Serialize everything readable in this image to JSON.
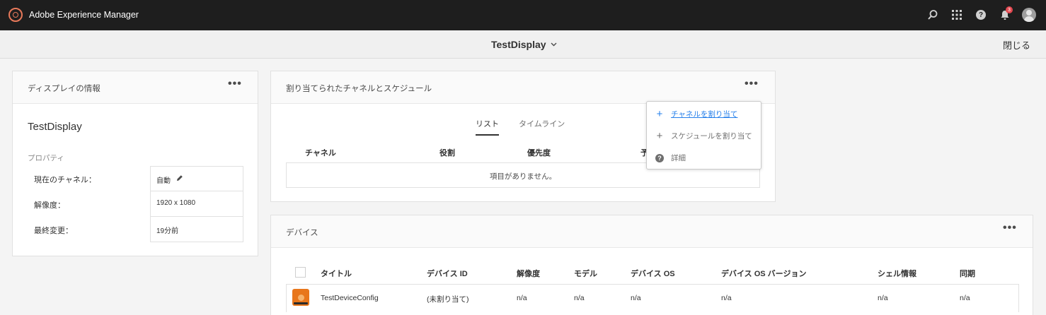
{
  "app": {
    "title": "Adobe Experience Manager",
    "notification_count": "3"
  },
  "header": {
    "page_title": "TestDisplay",
    "close_label": "閉じる"
  },
  "display_info": {
    "card_title": "ディスプレイの情報",
    "name": "TestDisplay",
    "properties_label": "プロパティ",
    "rows": [
      {
        "label": "現在のチャネル：",
        "value": "自動"
      },
      {
        "label": "解像度：",
        "value": "1920 x 1080"
      },
      {
        "label": "最終変更：",
        "value": "19分前"
      }
    ]
  },
  "channels": {
    "card_title": "割り当てられたチャネルとスケジュール",
    "tabs": [
      "リスト",
      "タイムライン"
    ],
    "columns": [
      "チャネル",
      "役割",
      "優先度",
      "予"
    ],
    "empty_text": "項目がありません。",
    "menu": {
      "assign_channel": "チャネルを割り当て",
      "assign_schedule": "スケジュールを割り当て",
      "details": "詳細"
    }
  },
  "devices": {
    "card_title": "デバイス",
    "columns": [
      "タイトル",
      "デバイス ID",
      "解像度",
      "モデル",
      "デバイス OS",
      "デバイス OS バージョン",
      "シェル情報",
      "同期"
    ],
    "rows": [
      {
        "title": "TestDeviceConfig",
        "device_id": "(未割り当て)",
        "resolution": "n/a",
        "model": "n/a",
        "os": "n/a",
        "os_version": "n/a",
        "shell": "n/a",
        "sync": "n/a"
      }
    ]
  }
}
